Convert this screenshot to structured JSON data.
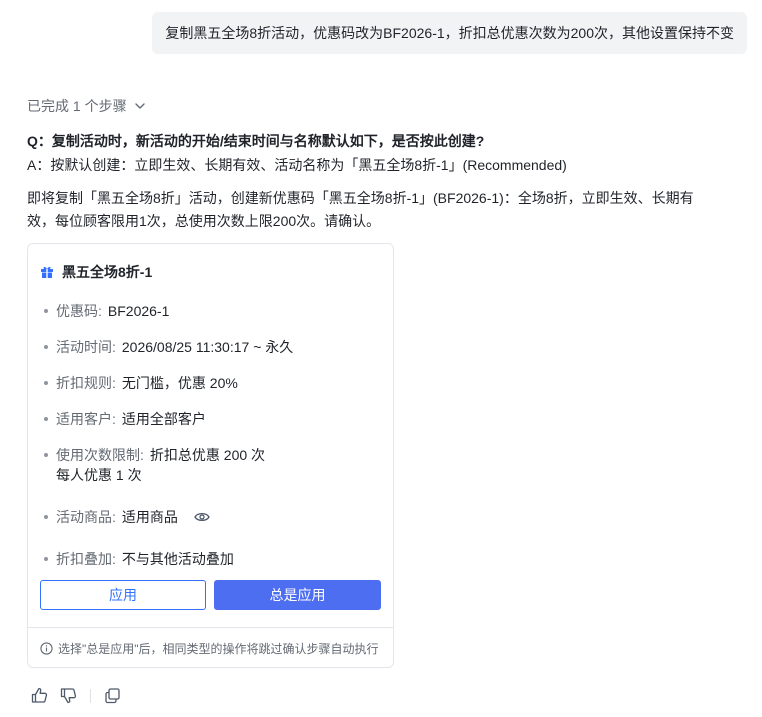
{
  "user_message": "复制黑五全场8折活动，优惠码改为BF2026-1，折扣总优惠次数为200次，其他设置保持不变",
  "steps": {
    "label": "已完成 1 个步骤"
  },
  "qa": {
    "question": "Q：复制活动时，新活动的开始/结束时间与名称默认如下，是否按此创建?",
    "answer": "A：按默认创建：立即生效、长期有效、活动名称为「黑五全场8折-1」(Recommended)"
  },
  "summary": "即将复制「黑五全场8折」活动，创建新优惠码「黑五全场8折-1」(BF2026-1)：全场8折，立即生效、长期有效，每位顾客限用1次，总使用次数上限200次。请确认。",
  "card": {
    "title": "黑五全场8折-1",
    "details": [
      {
        "label": "优惠码:",
        "value": "BF2026-1"
      },
      {
        "label": "活动时间:",
        "value": "2026/08/25 11:30:17 ~ 永久"
      },
      {
        "label": "折扣规则:",
        "value": "无门槛，优惠 20%"
      },
      {
        "label": "适用客户:",
        "value": "适用全部客户"
      },
      {
        "label": "使用次数限制:",
        "value": "折扣总优惠 200 次",
        "sub": "每人优惠 1 次"
      },
      {
        "label": "活动商品:",
        "value": "适用商品"
      },
      {
        "label": "折扣叠加:",
        "value": "不与其他活动叠加"
      }
    ],
    "apply_label": "应用",
    "always_apply_label": "总是应用",
    "footer_note": "选择\"总是应用\"后，相同类型的操作将跳过确认步骤自动执行"
  },
  "colors": {
    "accent": "#3370ff",
    "primary_button": "#4e6ef2",
    "bubble_bg": "#f2f3f5"
  },
  "icons": [
    "chevron-down-icon",
    "gift-icon",
    "eye-icon",
    "info-icon",
    "thumbs-up-icon",
    "thumbs-down-icon",
    "copy-icon"
  ]
}
